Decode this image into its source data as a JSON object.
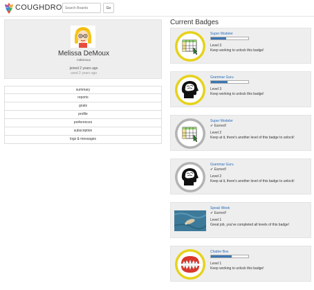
{
  "header": {
    "brand": "COUGHDROP",
    "search_placeholder": "Search Boards",
    "go_label": "Go"
  },
  "profile": {
    "name": "Melissa DeMoux",
    "username": "mdemoux",
    "joined": "joined 2 years ago",
    "used": "used 2 years ago"
  },
  "menu": {
    "items": [
      "summary",
      "reports",
      "goals",
      "profile",
      "preferences",
      "subscription",
      "logs & messages"
    ]
  },
  "badges": {
    "title": "Current Badges",
    "items": [
      {
        "name": "Super Modeler",
        "progress": 0.4,
        "earned": "",
        "level": "Level 3",
        "message": "Keep working to unlock this badge!",
        "icon": "modeling-grid-icon",
        "frame_color": "#e6d21a"
      },
      {
        "name": "Grammar Guru",
        "progress": 0.45,
        "earned": "",
        "level": "Level 3",
        "message": "Keep working to unlock this badge!",
        "icon": "brain-head-icon",
        "frame_color": "#e6d21a"
      },
      {
        "name": "Super Modeler",
        "progress": 1,
        "earned": "✔ Earned!",
        "level": "Level 2",
        "message": "Keep at it, there's another level of this badge to unlock!",
        "icon": "modeling-grid-icon",
        "frame_color": "#b3b3b3"
      },
      {
        "name": "Grammar Guru",
        "progress": 1,
        "earned": "✔ Earned!",
        "level": "Level 2",
        "message": "Keep at it, there's another level of this badge to unlock!",
        "icon": "brain-head-icon",
        "frame_color": "#b3b3b3"
      },
      {
        "name": "Speak Week",
        "progress": 1,
        "earned": "✔ Earned!",
        "level": "Level 1",
        "message": "Great job, you've completed all levels of this badge!",
        "icon": "speak-week-photo",
        "frame_color": ""
      },
      {
        "name": "Chatter Box",
        "progress": 0.55,
        "earned": "",
        "level": "Level 1",
        "message": "Keep working to unlock this badge!",
        "icon": "chatter-teeth-icon",
        "frame_color": "#e6d21a"
      }
    ]
  }
}
